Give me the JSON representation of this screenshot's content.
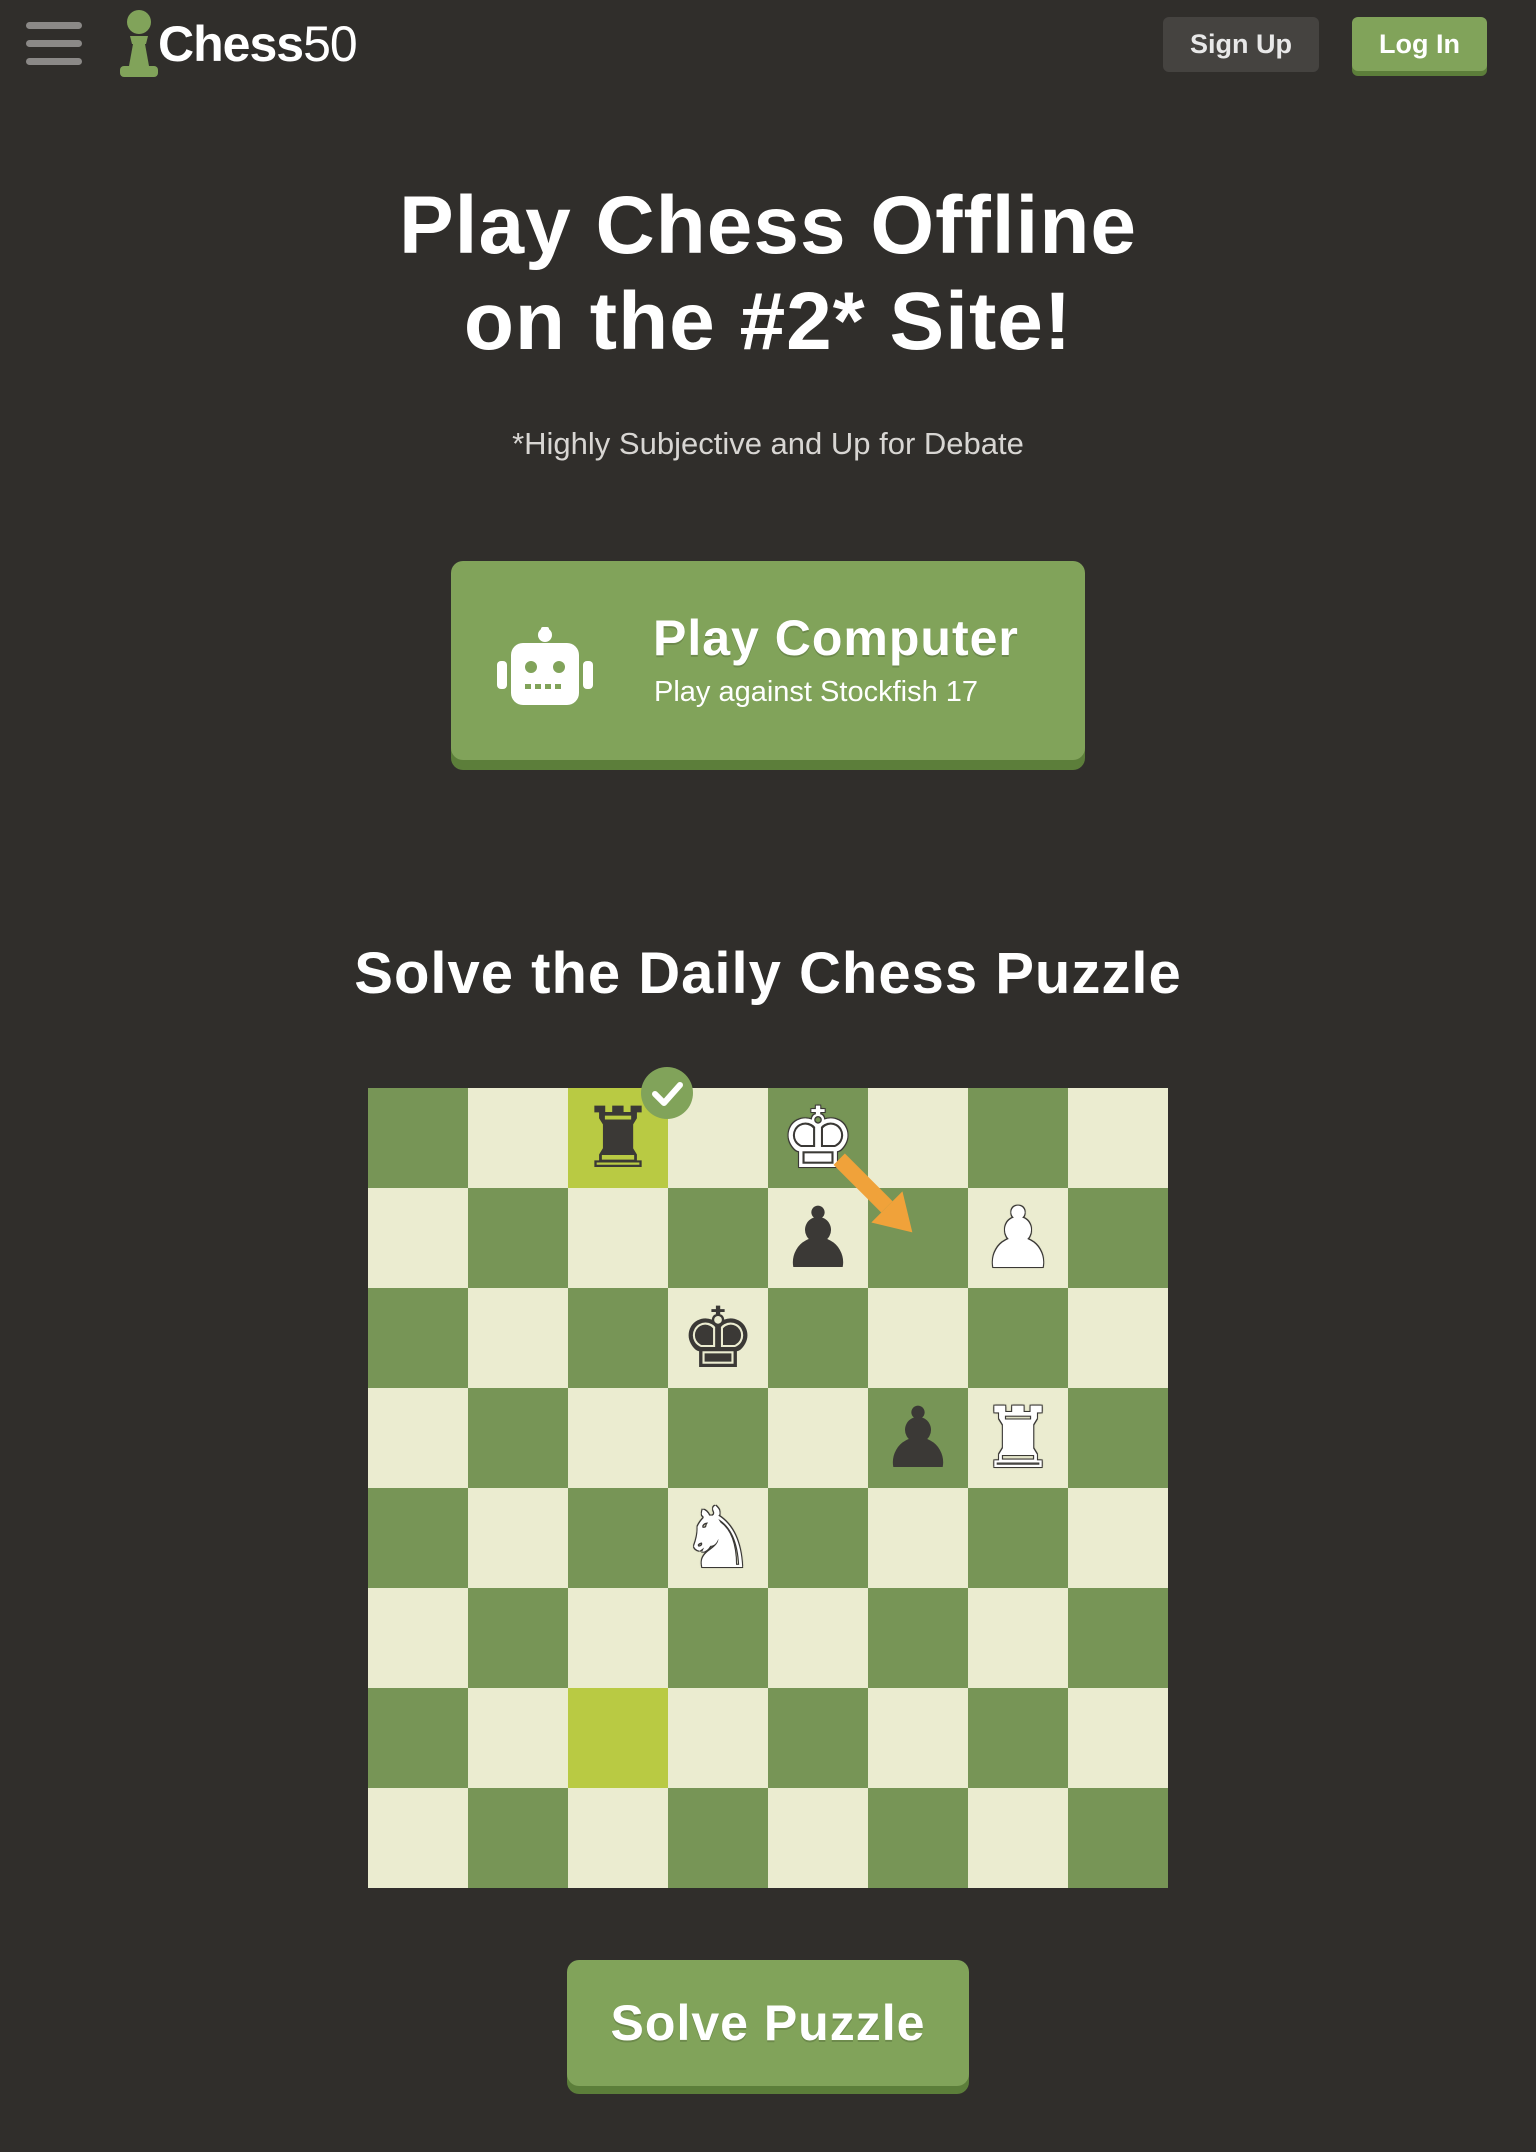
{
  "header": {
    "menu_icon": "hamburger-menu-icon",
    "logo_icon": "pawn-icon",
    "logo_text_bold": "Chess",
    "logo_text_num": "50",
    "signup_label": "Sign Up",
    "login_label": "Log In"
  },
  "hero": {
    "title_line1": "Play Chess Offline",
    "title_line2": "on the #2* Site!",
    "subtitle": "*Highly Subjective and Up for Debate"
  },
  "play_computer": {
    "icon": "robot-icon",
    "title": "Play Computer",
    "subtitle": "Play against Stockfish 17"
  },
  "puzzle": {
    "title": "Solve the Daily Chess Puzzle",
    "board": {
      "highlighted_squares": [
        "c8",
        "c2"
      ],
      "arrow": {
        "from": "e8",
        "to": "f7",
        "color": "#f0a23a"
      },
      "badge": {
        "square": "c8",
        "icon": "checkmark-icon"
      },
      "pieces": [
        {
          "square": "c8",
          "color": "black",
          "type": "rook",
          "glyph": "♜"
        },
        {
          "square": "e8",
          "color": "white",
          "type": "king",
          "glyph": "♚"
        },
        {
          "square": "e7",
          "color": "black",
          "type": "pawn",
          "glyph": "♟"
        },
        {
          "square": "g7",
          "color": "white",
          "type": "pawn",
          "glyph": "♟"
        },
        {
          "square": "d6",
          "color": "black",
          "type": "king",
          "glyph": "♚"
        },
        {
          "square": "f5",
          "color": "black",
          "type": "pawn",
          "glyph": "♟"
        },
        {
          "square": "g5",
          "color": "white",
          "type": "rook",
          "glyph": "♜"
        },
        {
          "square": "d4",
          "color": "white",
          "type": "knight",
          "glyph": "♞"
        }
      ]
    },
    "solve_label": "Solve Puzzle"
  },
  "colors": {
    "background": "#302e2b",
    "accent_green": "#81a35a",
    "board_light": "#ebecd0",
    "board_dark": "#779556",
    "highlight_yellow": "#f5f682",
    "highlight_green": "#b9ca43",
    "arrow_orange": "#f0a23a"
  }
}
